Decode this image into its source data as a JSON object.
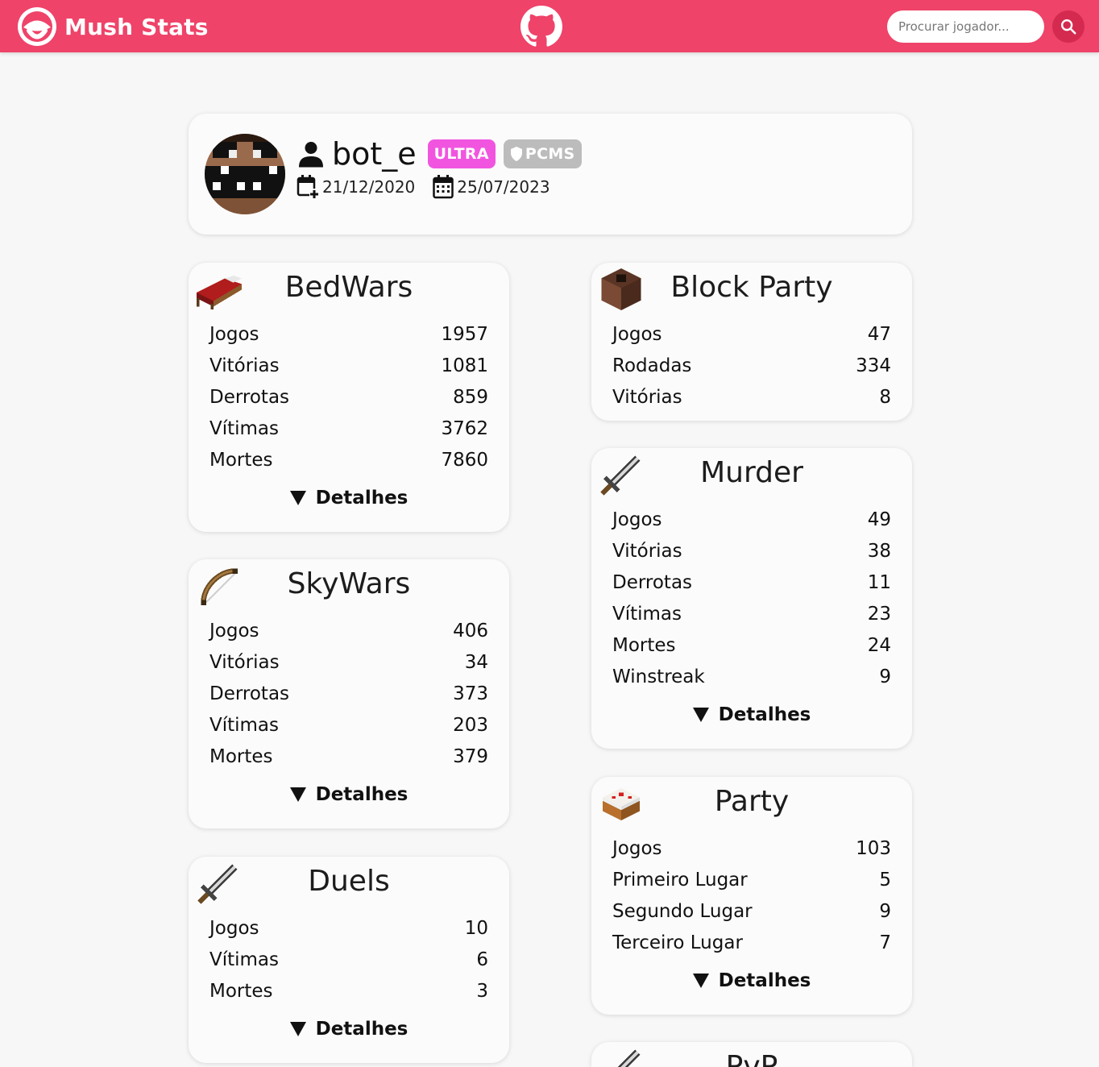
{
  "nav": {
    "brand": "Mush Stats",
    "search_placeholder": "Procurar jogador...",
    "colors": {
      "primary": "#ef4369",
      "button": "#d42a50"
    }
  },
  "profile": {
    "username": "bot_e",
    "badges": {
      "rank": "ULTRA",
      "clan": "PCMS"
    },
    "first_login": "21/12/2020",
    "last_login": "25/07/2023"
  },
  "games": {
    "bedwars": {
      "title": "BedWars",
      "icon": "bed-icon",
      "stats": [
        {
          "label": "Jogos",
          "value": "1957"
        },
        {
          "label": "Vitórias",
          "value": "1081"
        },
        {
          "label": "Derrotas",
          "value": "859"
        },
        {
          "label": "Vítimas",
          "value": "3762"
        },
        {
          "label": "Mortes",
          "value": "7860"
        }
      ],
      "details": "Detalhes"
    },
    "skywars": {
      "title": "SkyWars",
      "icon": "bow-icon",
      "stats": [
        {
          "label": "Jogos",
          "value": "406"
        },
        {
          "label": "Vitórias",
          "value": "34"
        },
        {
          "label": "Derrotas",
          "value": "373"
        },
        {
          "label": "Vítimas",
          "value": "203"
        },
        {
          "label": "Mortes",
          "value": "379"
        }
      ],
      "details": "Detalhes"
    },
    "duels": {
      "title": "Duels",
      "icon": "sword-icon",
      "stats": [
        {
          "label": "Jogos",
          "value": "10"
        },
        {
          "label": "Vítimas",
          "value": "6"
        },
        {
          "label": "Mortes",
          "value": "3"
        }
      ],
      "details": "Detalhes"
    },
    "blockparty": {
      "title": "Block Party",
      "icon": "note-block-icon",
      "stats": [
        {
          "label": "Jogos",
          "value": "47"
        },
        {
          "label": "Rodadas",
          "value": "334"
        },
        {
          "label": "Vitórias",
          "value": "8"
        }
      ]
    },
    "murder": {
      "title": "Murder",
      "icon": "sword-icon",
      "stats": [
        {
          "label": "Jogos",
          "value": "49"
        },
        {
          "label": "Vitórias",
          "value": "38"
        },
        {
          "label": "Derrotas",
          "value": "11"
        },
        {
          "label": "Vítimas",
          "value": "23"
        },
        {
          "label": "Mortes",
          "value": "24"
        },
        {
          "label": "Winstreak",
          "value": "9"
        }
      ],
      "details": "Detalhes"
    },
    "party": {
      "title": "Party",
      "icon": "cake-icon",
      "stats": [
        {
          "label": "Jogos",
          "value": "103"
        },
        {
          "label": "Primeiro Lugar",
          "value": "5"
        },
        {
          "label": "Segundo Lugar",
          "value": "9"
        },
        {
          "label": "Terceiro Lugar",
          "value": "7"
        }
      ],
      "details": "Detalhes"
    },
    "pvp": {
      "title": "PvP",
      "icon": "sword-icon"
    }
  }
}
